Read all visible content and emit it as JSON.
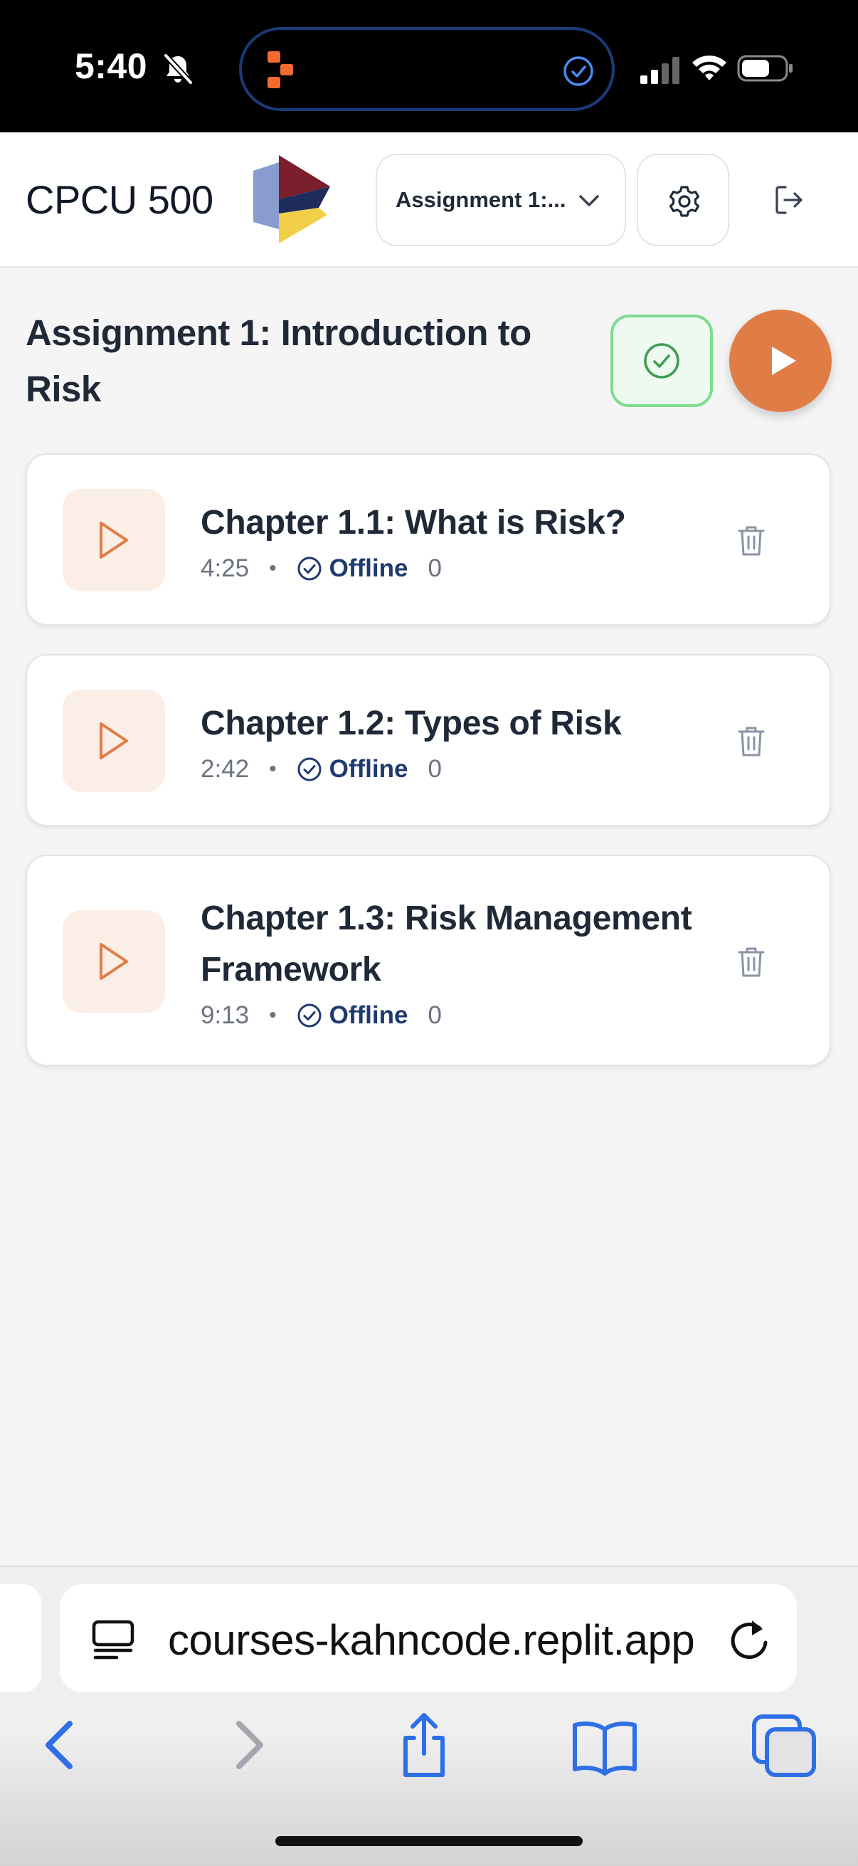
{
  "status_bar": {
    "time": "5:40",
    "icons": [
      "bell-slash-icon",
      "app-icon",
      "check-circle-icon",
      "signal-icon",
      "wifi-icon",
      "battery-icon"
    ]
  },
  "header": {
    "app_title": "CPCU 500",
    "assignment_selector": "Assignment 1:...",
    "icons": [
      "logo-icon",
      "chevron-down-icon",
      "gear-icon",
      "logout-icon"
    ]
  },
  "main": {
    "page_title": "Assignment 1: Introduction to Risk",
    "chapters": [
      {
        "title": "Chapter 1.1: What is Risk?",
        "duration": "4:25",
        "status": "Offline",
        "count": "0"
      },
      {
        "title": "Chapter 1.2: Types of Risk",
        "duration": "2:42",
        "status": "Offline",
        "count": "0"
      },
      {
        "title": "Chapter 1.3: Risk Management Framework",
        "duration": "9:13",
        "status": "Offline",
        "count": "0"
      }
    ],
    "meta_separator": "•"
  },
  "safari": {
    "url": "courses-kahncode.replit.app",
    "icons": [
      "page-menu-icon",
      "reload-icon",
      "back-icon",
      "forward-icon",
      "share-icon",
      "bookmarks-icon",
      "tabs-icon"
    ]
  },
  "colors": {
    "accent": "#e07d47",
    "success": "#3f9d55",
    "offline": "#1e3a6e",
    "safari_blue": "#2f6fe6"
  }
}
